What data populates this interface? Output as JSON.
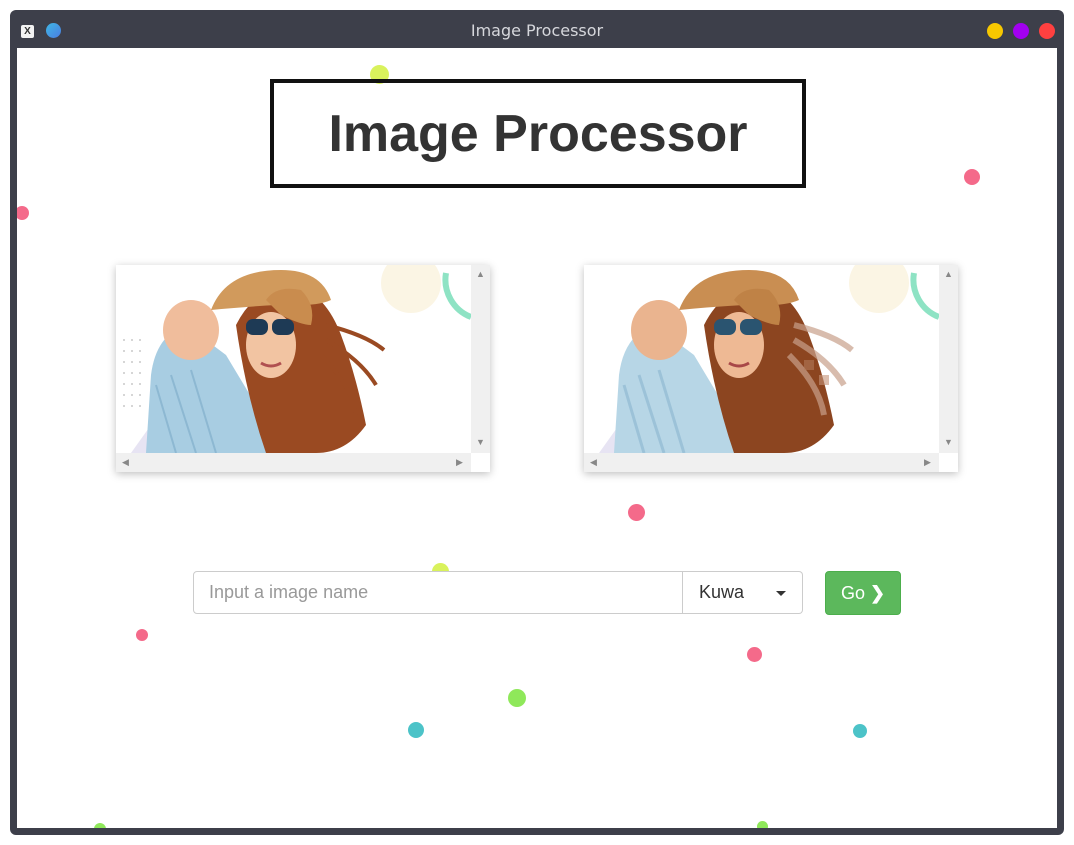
{
  "window": {
    "title": "Image Processor"
  },
  "page": {
    "heading": "Image Processor"
  },
  "search": {
    "placeholder": "Input a image name",
    "value": ""
  },
  "filter": {
    "selected": "Kuwa"
  },
  "go_button": {
    "label": "Go",
    "icon": "chevron-right-icon"
  },
  "viewers": [
    {
      "name": "original-image"
    },
    {
      "name": "processed-image"
    }
  ],
  "colors": {
    "go_green": "#5cb85c",
    "titlebar": "#3d3f4a",
    "dot_pink": "#f46a8a",
    "dot_lime": "#d9f25c",
    "dot_green": "#8fe85a",
    "dot_teal": "#4cc3c8"
  }
}
